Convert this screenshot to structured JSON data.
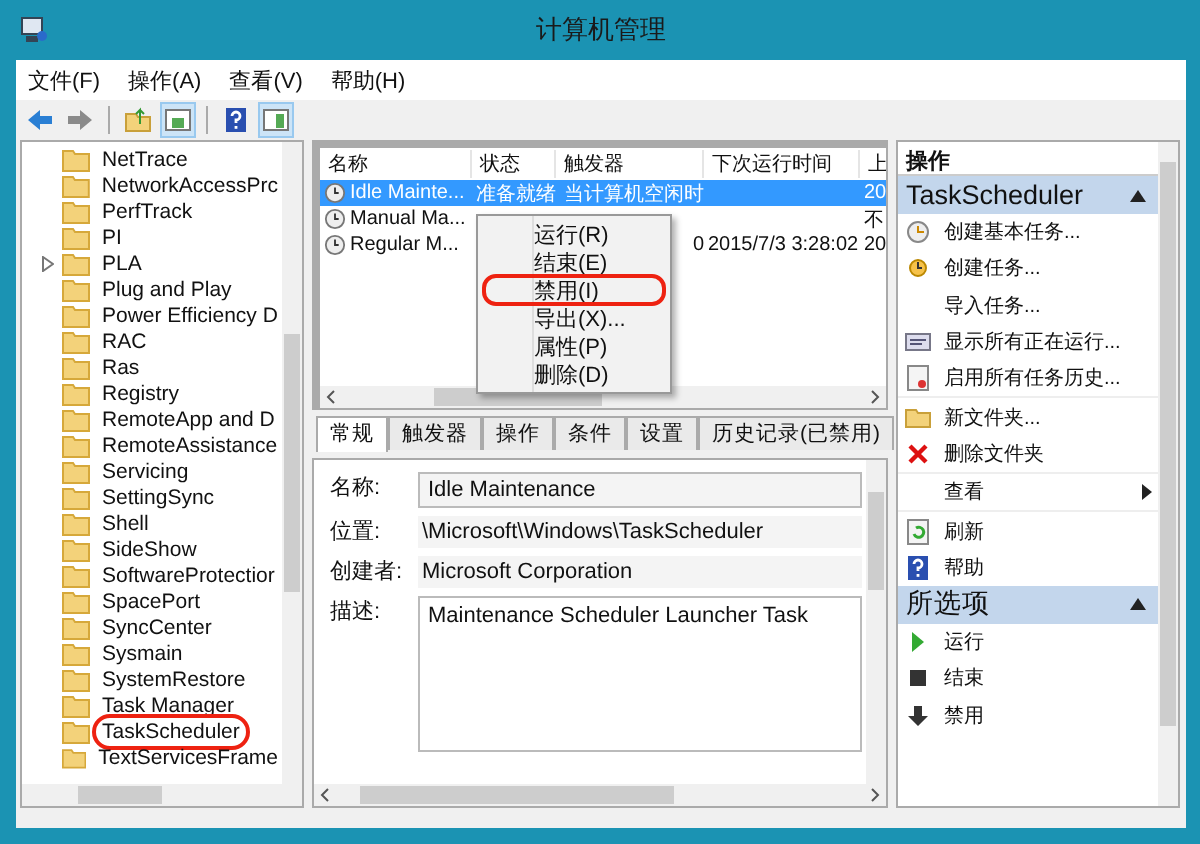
{
  "window": {
    "title": "计算机管理"
  },
  "menu": [
    "文件(F)",
    "操作(A)",
    "查看(V)",
    "帮助(H)"
  ],
  "tree": {
    "items": [
      {
        "label": "NetTrace",
        "expandable": false,
        "annotated": false
      },
      {
        "label": "NetworkAccessPrc",
        "expandable": false,
        "annotated": false
      },
      {
        "label": "PerfTrack",
        "expandable": false,
        "annotated": false
      },
      {
        "label": "PI",
        "expandable": false,
        "annotated": false
      },
      {
        "label": "PLA",
        "expandable": true,
        "annotated": false
      },
      {
        "label": "Plug and Play",
        "expandable": false,
        "annotated": false
      },
      {
        "label": "Power Efficiency D",
        "expandable": false,
        "annotated": false
      },
      {
        "label": "RAC",
        "expandable": false,
        "annotated": false
      },
      {
        "label": "Ras",
        "expandable": false,
        "annotated": false
      },
      {
        "label": "Registry",
        "expandable": false,
        "annotated": false
      },
      {
        "label": "RemoteApp and D",
        "expandable": false,
        "annotated": false
      },
      {
        "label": "RemoteAssistance",
        "expandable": false,
        "annotated": false
      },
      {
        "label": "Servicing",
        "expandable": false,
        "annotated": false
      },
      {
        "label": "SettingSync",
        "expandable": false,
        "annotated": false
      },
      {
        "label": "Shell",
        "expandable": false,
        "annotated": false
      },
      {
        "label": "SideShow",
        "expandable": false,
        "annotated": false
      },
      {
        "label": "SoftwareProtectior",
        "expandable": false,
        "annotated": false
      },
      {
        "label": "SpacePort",
        "expandable": false,
        "annotated": false
      },
      {
        "label": "SyncCenter",
        "expandable": false,
        "annotated": false
      },
      {
        "label": "Sysmain",
        "expandable": false,
        "annotated": false
      },
      {
        "label": "SystemRestore",
        "expandable": false,
        "annotated": false
      },
      {
        "label": "Task Manager",
        "expandable": false,
        "annotated": false
      },
      {
        "label": "TaskScheduler",
        "expandable": false,
        "annotated": true
      },
      {
        "label": "TextServicesFrame",
        "expandable": false,
        "annotated": false
      }
    ]
  },
  "task_list": {
    "columns": [
      "名称",
      "状态",
      "触发器",
      "下次运行时间",
      "上"
    ],
    "rows": [
      {
        "name": "Idle Mainte...",
        "status": "准备就绪",
        "trigger": "当计算机空闲时",
        "column_5": "20",
        "selected": true
      },
      {
        "name": "Manual Ma...",
        "column_5": "不",
        "selected": false
      },
      {
        "name": "Regular M...",
        "trigger": "0",
        "next_run": "2015/7/3 3:28:02",
        "column_5": "20",
        "selected": false
      }
    ]
  },
  "context_menu": {
    "items": [
      {
        "label": "运行(R)",
        "annotated": false
      },
      {
        "label": "结束(E)",
        "annotated": false
      },
      {
        "label": "禁用(I)",
        "annotated": true
      },
      {
        "label": "导出(X)...",
        "annotated": false
      },
      {
        "label": "属性(P)",
        "annotated": false
      },
      {
        "label": "删除(D)",
        "annotated": false
      }
    ]
  },
  "tabs": [
    {
      "label": "常规",
      "selected": true
    },
    {
      "label": "触发器",
      "selected": false
    },
    {
      "label": "操作",
      "selected": false
    },
    {
      "label": "条件",
      "selected": false
    },
    {
      "label": "设置",
      "selected": false
    },
    {
      "label": "历史记录(已禁用)",
      "selected": false
    }
  ],
  "details": [
    {
      "kind": "field",
      "label": "名称:",
      "value": "Idle Maintenance"
    },
    {
      "kind": "text",
      "label": "位置:",
      "value": "\\Microsoft\\Windows\\TaskScheduler"
    },
    {
      "kind": "text",
      "label": "创建者:",
      "value": "Microsoft Corporation"
    },
    {
      "kind": "area",
      "label": "描述:",
      "value": "Maintenance Scheduler Launcher Task"
    }
  ],
  "actions": {
    "header": "操作",
    "sections": [
      {
        "title": "TaskScheduler",
        "items": [
          {
            "label": "创建基本任务...",
            "submenu": false
          },
          {
            "label": "创建任务...",
            "submenu": false
          },
          {
            "label": "导入任务...",
            "submenu": false
          },
          {
            "label": "显示所有正在运行...",
            "submenu": false
          },
          {
            "label": "启用所有任务历史...",
            "submenu": false
          },
          {
            "label": "新文件夹...",
            "submenu": false
          },
          {
            "label": "删除文件夹",
            "submenu": false
          },
          {
            "label": "查看",
            "submenu": true
          },
          {
            "label": "刷新",
            "submenu": false
          },
          {
            "label": "帮助",
            "submenu": false
          }
        ]
      },
      {
        "title": "所选项",
        "items": [
          {
            "label": "运行",
            "submenu": false
          },
          {
            "label": "结束",
            "submenu": false
          },
          {
            "label": "禁用",
            "submenu": false
          }
        ]
      }
    ]
  }
}
